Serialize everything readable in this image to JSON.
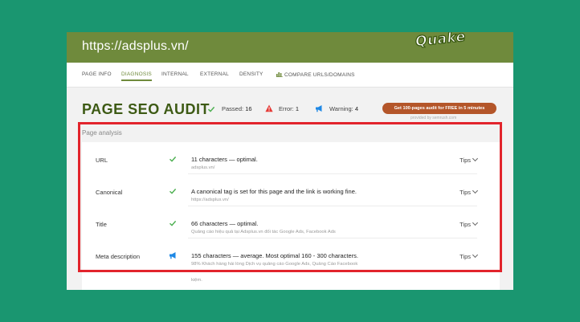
{
  "header": {
    "url": "https://adsplus.vn/",
    "logo_text": "Quake"
  },
  "nav": {
    "items": [
      {
        "label": "PAGE INFO"
      },
      {
        "label": "DIAGNOSIS"
      },
      {
        "label": "INTERNAL"
      },
      {
        "label": "EXTERNAL"
      },
      {
        "label": "DENSITY"
      },
      {
        "label": "COMPARE URLS/DOMAINS"
      }
    ],
    "active": "DIAGNOSIS"
  },
  "audit": {
    "title": "PAGE SEO AUDIT",
    "passed_label": "Passed:",
    "passed_count": "16",
    "error_label": "Error:",
    "error_count": "1",
    "warning_label": "Warning:",
    "warning_count": "4",
    "cta_label": "Get 100-pages audit for FREE in 5 minutes",
    "provided_by": "provided by semrush.com"
  },
  "analysis": {
    "section_label": "Page analysis",
    "tips_label": "Tips",
    "rows": [
      {
        "label": "URL",
        "status": "pass",
        "main": "11 characters — optimal.",
        "sub": "adsplus.vn/"
      },
      {
        "label": "Canonical",
        "status": "pass",
        "main": "A canonical tag is set for this page and the link is working fine.",
        "sub": "https://adsplus.vn/"
      },
      {
        "label": "Title",
        "status": "pass",
        "main": "66 characters — optimal.",
        "sub": "Quảng cáo hiệu quả tại Adsplus.vn đối tác Google Ads, Facebook Ads"
      },
      {
        "label": "Meta description",
        "status": "warning",
        "main": "155 characters — average. Most optimal 160 - 300 characters.",
        "sub": "98% Khách hàng hài lòng Dịch vụ quảng cáo Google Ads, Quảng Cáo Facebook",
        "sub2": "kiệm."
      }
    ]
  },
  "colors": {
    "header_green": "#6f8a3c",
    "title_green": "#3d5a14",
    "pass": "#4caf50",
    "error": "#e53935",
    "warning": "#1e88e5",
    "cta": "#b4562a",
    "highlight": "#e2242c",
    "background": "#1a9670"
  }
}
